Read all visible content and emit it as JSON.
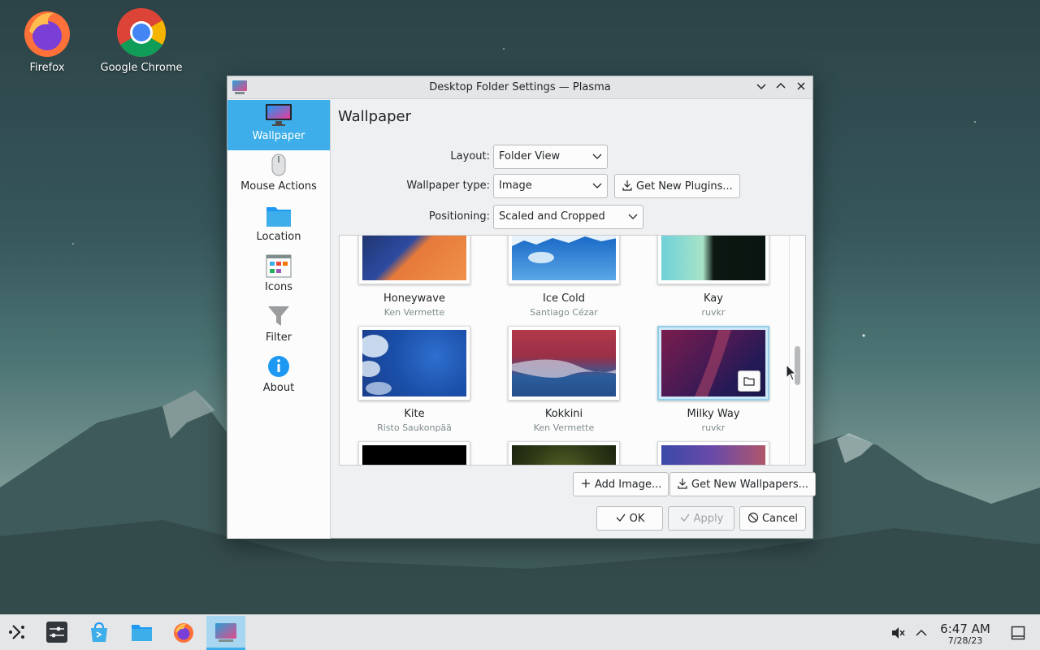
{
  "desktop": {
    "icons": [
      {
        "label": "Firefox"
      },
      {
        "label": "Google Chrome"
      }
    ]
  },
  "dialog": {
    "title": "Desktop Folder Settings — Plasma",
    "sidebar": [
      {
        "label": "Wallpaper",
        "active": true
      },
      {
        "label": "Mouse Actions"
      },
      {
        "label": "Location"
      },
      {
        "label": "Icons"
      },
      {
        "label": "Filter"
      },
      {
        "label": "About"
      }
    ],
    "page_title": "Wallpaper",
    "form": {
      "layout_label": "Layout:",
      "layout_value": "Folder View",
      "type_label": "Wallpaper type:",
      "type_value": "Image",
      "get_plugins": "Get New Plugins...",
      "positioning_label": "Positioning:",
      "positioning_value": "Scaled and Cropped"
    },
    "wallpapers": [
      {
        "name": "Honeywave",
        "author": "Ken Vermette"
      },
      {
        "name": "Ice Cold",
        "author": "Santiago Cézar"
      },
      {
        "name": "Kay",
        "author": "ruvkr"
      },
      {
        "name": "Kite",
        "author": "Risto Saukonpää"
      },
      {
        "name": "Kokkini",
        "author": "Ken Vermette"
      },
      {
        "name": "Milky Way",
        "author": "ruvkr",
        "selected": true
      }
    ],
    "buttons": {
      "add_image": "Add Image...",
      "get_wallpapers": "Get New Wallpapers...",
      "ok": "OK",
      "apply": "Apply",
      "cancel": "Cancel"
    }
  },
  "taskbar": {
    "time": "6:47 AM",
    "date": "7/28/23"
  },
  "colors": {
    "accent": "#3daee9",
    "window_bg": "#eff0f1"
  }
}
